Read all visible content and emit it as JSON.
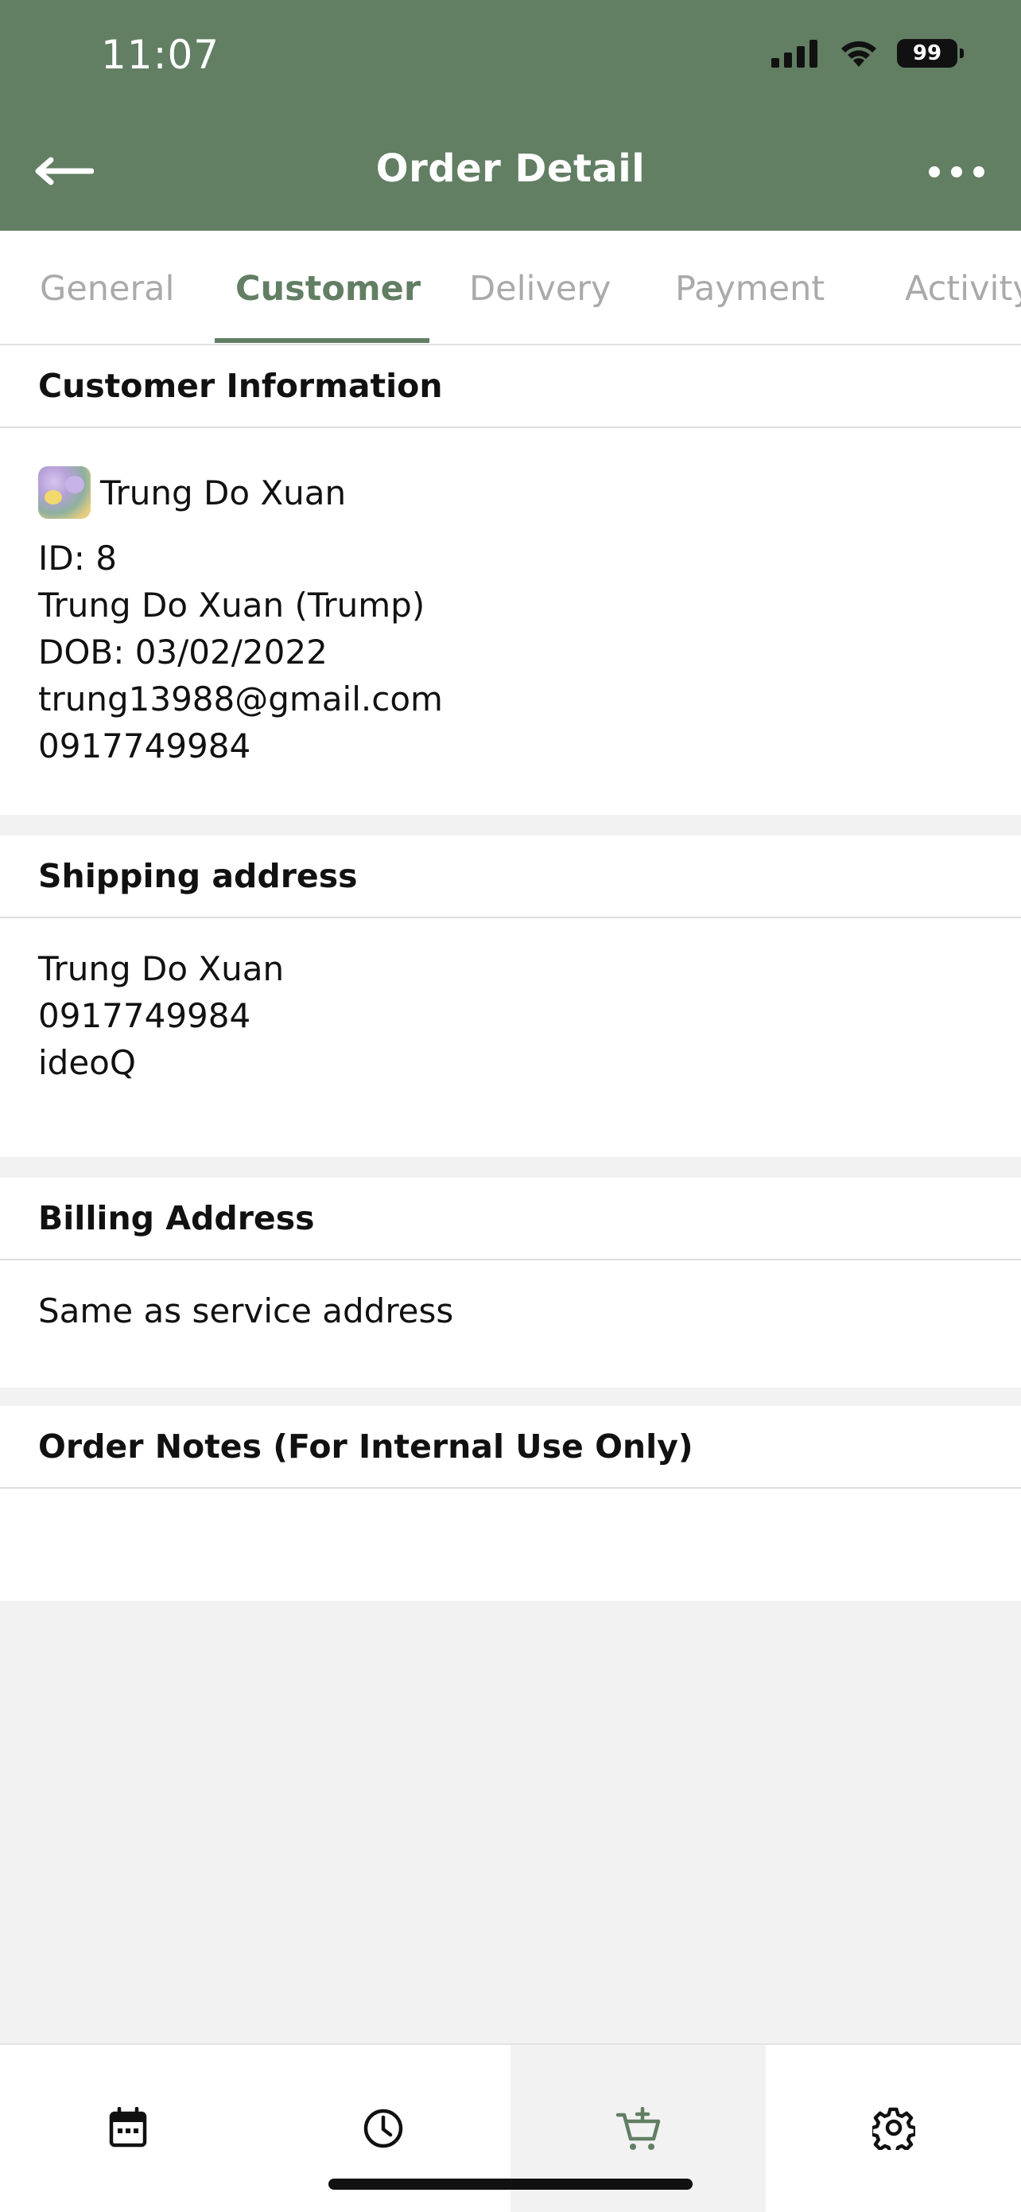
{
  "status_bar": {
    "time": "11:07",
    "battery": "99"
  },
  "header": {
    "title": "Order Detail",
    "back_icon": "arrow-left-icon",
    "more_icon": "more-horizontal-icon"
  },
  "tabs": [
    {
      "label": "General",
      "active": false
    },
    {
      "label": "Customer",
      "active": true
    },
    {
      "label": "Delivery",
      "active": false
    },
    {
      "label": "Payment",
      "active": false
    },
    {
      "label": "Activity",
      "active": false
    }
  ],
  "customer_info": {
    "title": "Customer Information",
    "name": "Trung Do Xuan",
    "id_line": "ID: 8",
    "full_name": "Trung Do Xuan (Trump)",
    "dob": "DOB: 03/02/2022",
    "email": "trung13988@gmail.com",
    "phone": "0917749984"
  },
  "shipping": {
    "title": "Shipping address",
    "name": "Trung Do Xuan",
    "phone": "0917749984",
    "address": "ideoQ"
  },
  "billing": {
    "title": "Billing Address",
    "text": "Same as service address"
  },
  "notes": {
    "title": "Order Notes (For Internal Use Only)"
  },
  "bottom_nav": [
    {
      "icon": "calendar-icon",
      "active": false
    },
    {
      "icon": "clock-icon",
      "active": false
    },
    {
      "icon": "cart-add-icon",
      "active": true
    },
    {
      "icon": "gear-icon",
      "active": false
    }
  ],
  "colors": {
    "brand": "#627e63",
    "tab_inactive": "#aaaaaa",
    "background": "#f2f2f2"
  }
}
